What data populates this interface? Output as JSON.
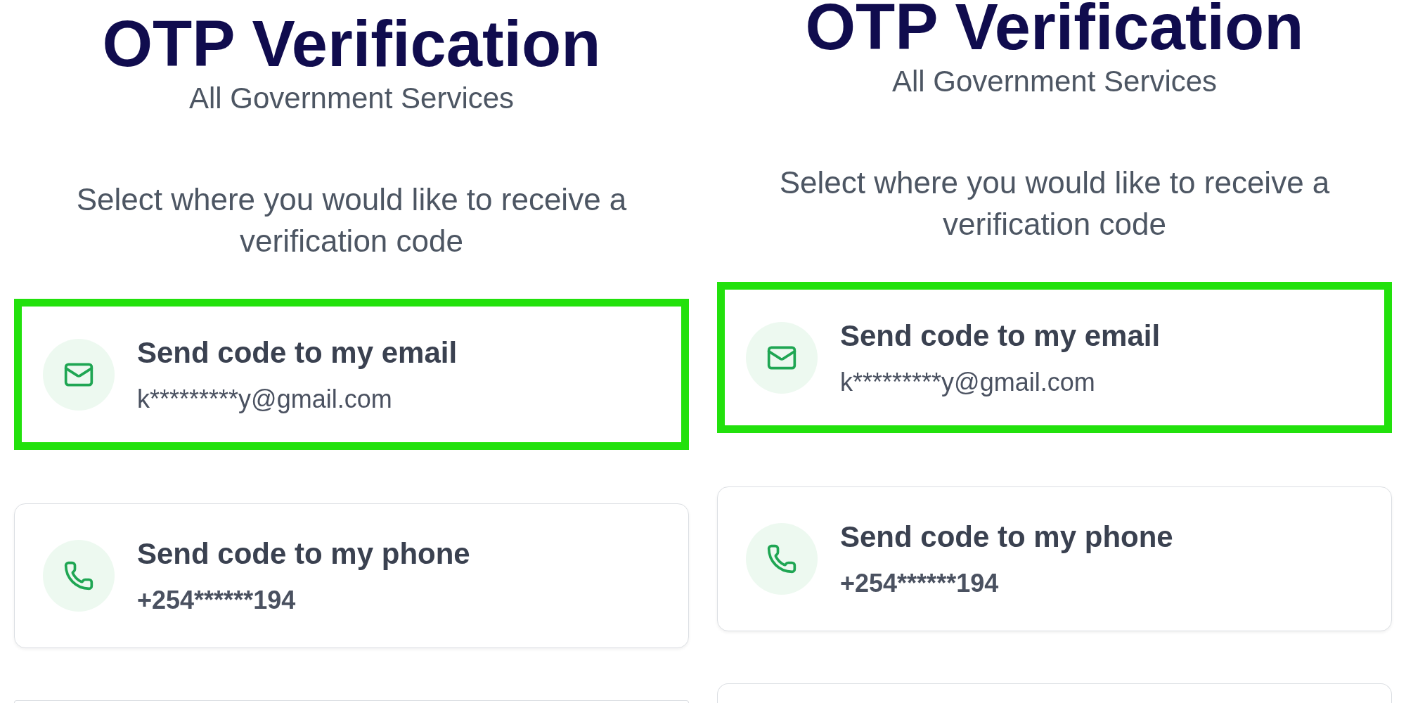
{
  "panels": [
    {
      "title": "OTP Verification",
      "subtitle": "All Government Services",
      "prompt": "Select where you would like to receive a verification code",
      "options": [
        {
          "kind": "email",
          "label": "Send code to my email",
          "detail": "k*********y@gmail.com",
          "selected": true
        },
        {
          "kind": "phone",
          "label": "Send code to my phone",
          "detail": "+254******194",
          "selected": false
        },
        {
          "kind": "cut_off",
          "selected": false
        }
      ]
    },
    {
      "title": "OTP Verification",
      "subtitle": "All Government Services",
      "prompt": "Select where you would like to receive a verification code",
      "options": [
        {
          "kind": "email",
          "label": "Send code to my email",
          "detail": "k*********y@gmail.com",
          "selected": true
        },
        {
          "kind": "phone",
          "label": "Send code to my phone",
          "detail": "+254******194",
          "selected": false
        },
        {
          "kind": "cut_off",
          "selected": false
        }
      ]
    }
  ]
}
